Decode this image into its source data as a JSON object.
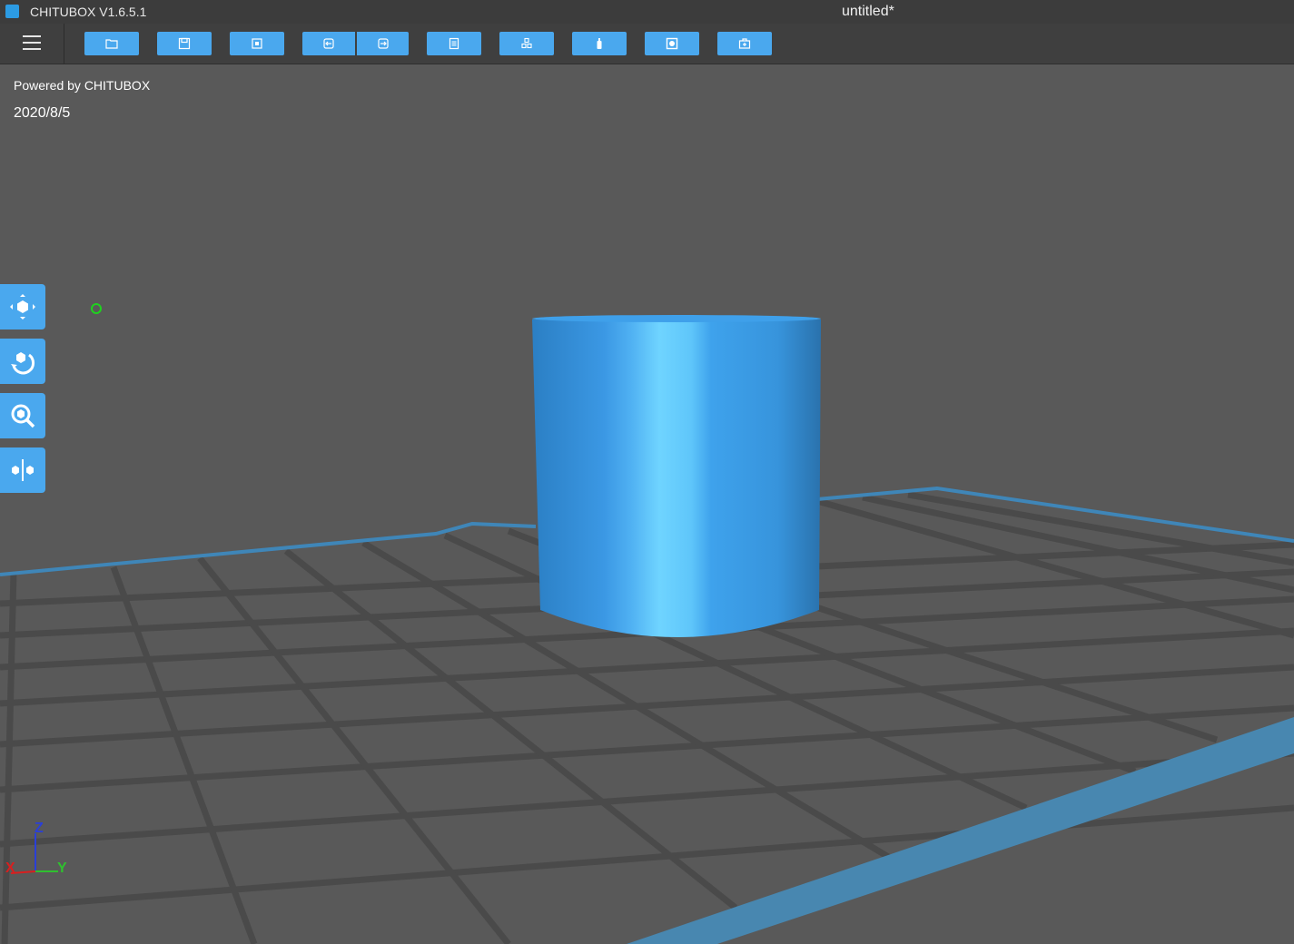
{
  "titlebar": {
    "app_title": "CHITUBOX V1.6.5.1",
    "document_title": "untitled*"
  },
  "toolbar": {
    "menu_icon": "hamburger-menu-icon",
    "buttons": [
      {
        "name": "open-file-button",
        "icon": "folder-icon"
      },
      {
        "name": "save-button",
        "icon": "save-icon"
      },
      {
        "name": "screenshot-button",
        "icon": "crop-frame-icon"
      },
      {
        "name": "undo-button",
        "icon": "arrow-left-icon"
      },
      {
        "name": "redo-button",
        "icon": "arrow-right-icon"
      },
      {
        "name": "model-list-button",
        "icon": "document-list-icon"
      },
      {
        "name": "arrange-button",
        "icon": "cubes-icon"
      },
      {
        "name": "slice-button",
        "icon": "bottle-icon"
      },
      {
        "name": "hollow-button",
        "icon": "hollow-square-icon"
      },
      {
        "name": "add-hole-button",
        "icon": "toolbox-icon"
      }
    ]
  },
  "overlay": {
    "powered_by": "Powered by CHITUBOX",
    "date": "2020/8/5"
  },
  "side_tools": [
    {
      "name": "move-tool-button",
      "icon": "move-cube-icon"
    },
    {
      "name": "rotate-tool-button",
      "icon": "rotate-cube-icon"
    },
    {
      "name": "scale-tool-button",
      "icon": "zoom-cube-icon"
    },
    {
      "name": "mirror-tool-button",
      "icon": "mirror-cube-icon"
    }
  ],
  "axis_indicator": {
    "x": "X",
    "y": "Y",
    "z": "Z"
  },
  "colors": {
    "background": "#595959",
    "accent": "#4aa8ee",
    "plate_edge": "#3f86b8",
    "grid_line": "#4a4a4a",
    "model_blue": "#3aa0f0",
    "marker_green": "#1fd11f"
  }
}
